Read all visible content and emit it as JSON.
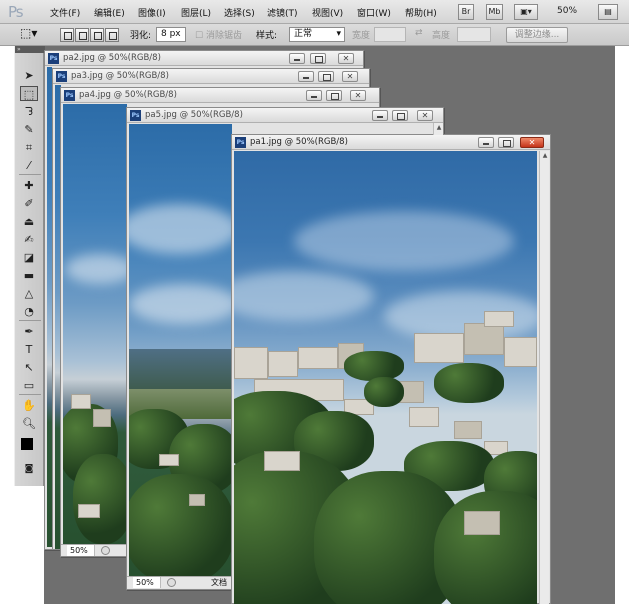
{
  "app": {
    "logo": "Ps"
  },
  "menu": {
    "items": [
      "文件(F)",
      "编辑(E)",
      "图像(I)",
      "图层(L)",
      "选择(S)",
      "滤镜(T)",
      "视图(V)",
      "窗口(W)",
      "帮助(H)"
    ],
    "br_label": "Br",
    "mb_label": "Mb",
    "zoom": "50%"
  },
  "options": {
    "feather_label": "羽化:",
    "feather_value": "8 px",
    "antialias_label": "消除锯齿",
    "style_label": "样式:",
    "style_value": "正常",
    "width_label": "宽度",
    "height_label": "高度",
    "refine_edge_button": "调整边缘..."
  },
  "documents": [
    {
      "title": "pa2.jpg @ 50%(RGB/8)",
      "active": false
    },
    {
      "title": "pa3.jpg @ 50%(RGB/8)",
      "active": false
    },
    {
      "title": "pa4.jpg @ 50%(RGB/8)",
      "active": false
    },
    {
      "title": "pa5.jpg @ 50%(RGB/8)",
      "active": false,
      "status_zoom": "50%",
      "status_info": "文档"
    },
    {
      "title": "pa1.jpg @ 50%(RGB/8)",
      "active": true
    }
  ],
  "back_status": {
    "zoom": "50%"
  },
  "colors": {
    "workspace": "#6f6f6f",
    "close_hot": "#d2432a",
    "ps_badge": "#1b3f7a"
  }
}
